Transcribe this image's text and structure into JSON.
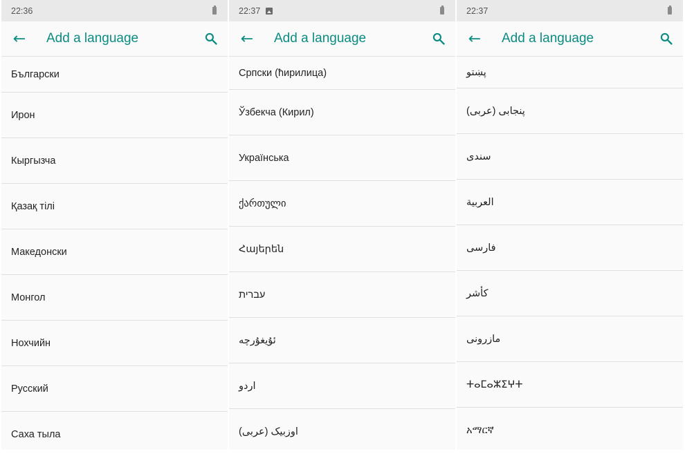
{
  "panels": [
    {
      "time": "22:36",
      "show_image_icon": false,
      "title": "Add a language",
      "languages": [
        "Български",
        "Ирон",
        "Кыргызча",
        "Қазақ тілі",
        "Македонски",
        "Монгол",
        "Нохчийн",
        "Русский",
        "Саха тыла"
      ]
    },
    {
      "time": "22:37",
      "show_image_icon": true,
      "title": "Add a language",
      "languages": [
        "Српски (ћирилица)",
        "Ўзбекча (Кирил)",
        "Українська",
        "ქართული",
        "Հայերեն",
        "עברית",
        "ئۇيغۇرچە",
        "اردو",
        "اوزبیک (عربی)"
      ]
    },
    {
      "time": "22:37",
      "show_image_icon": false,
      "title": "Add a language",
      "languages": [
        "پښتو",
        "پنجابی (عربی)",
        "سندی",
        "العربية",
        "فارسی",
        "كأشر",
        "مازرونی",
        "ⵜⴰⵎⴰⵣⵉⵖⵜ",
        "አማርኛ"
      ]
    }
  ],
  "icons": {
    "back": "arrow-left-icon",
    "search": "search-icon",
    "battery": "battery-icon",
    "image": "image-notification-icon"
  },
  "colors": {
    "accent": "#0b8c82",
    "statusbar": "#e9e9e9",
    "background": "#fafafa",
    "divider": "#dedede"
  }
}
